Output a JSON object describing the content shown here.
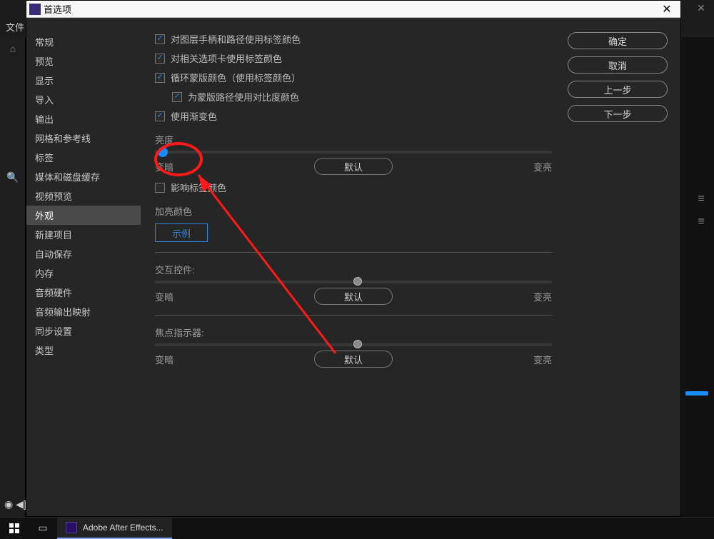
{
  "app_bg": {
    "menu_file": "文件",
    "play_icons": "◉ ◀]",
    "taskbar_app": "Adobe After Effects..."
  },
  "dialog": {
    "title": "首选项",
    "close": "✕"
  },
  "sidebar": {
    "items": [
      {
        "label": "常规"
      },
      {
        "label": "预览"
      },
      {
        "label": "显示"
      },
      {
        "label": "导入"
      },
      {
        "label": "输出"
      },
      {
        "label": "网格和参考线"
      },
      {
        "label": "标签"
      },
      {
        "label": "媒体和磁盘缓存"
      },
      {
        "label": "视频预览"
      },
      {
        "label": "外观"
      },
      {
        "label": "新建项目"
      },
      {
        "label": "自动保存"
      },
      {
        "label": "内存"
      },
      {
        "label": "音频硬件"
      },
      {
        "label": "音频输出映射"
      },
      {
        "label": "同步设置"
      },
      {
        "label": "类型"
      }
    ],
    "selected_index": 9
  },
  "checks": {
    "c1": "对图层手柄和路径使用标签颜色",
    "c2": "对相关选项卡使用标签颜色",
    "c3": "循环蒙版颜色（使用标签颜色）",
    "c3a": "为蒙版路径使用对比度颜色",
    "c4": "使用渐变色",
    "affect": "影响标签颜色"
  },
  "sliders": {
    "brightness": {
      "title": "亮度",
      "left": "变暗",
      "right": "变亮",
      "default_btn": "默认",
      "pos": 1
    },
    "interactive": {
      "title": "交互控件:",
      "left": "变暗",
      "right": "变亮",
      "default_btn": "默认",
      "pos": 50
    },
    "focus": {
      "title": "焦点指示器:",
      "left": "变暗",
      "right": "变亮",
      "default_btn": "默认",
      "pos": 50
    }
  },
  "accent": {
    "title": "加亮颜色",
    "example": "示例"
  },
  "actions": {
    "ok": "确定",
    "cancel": "取消",
    "prev": "上一步",
    "next": "下一步"
  }
}
